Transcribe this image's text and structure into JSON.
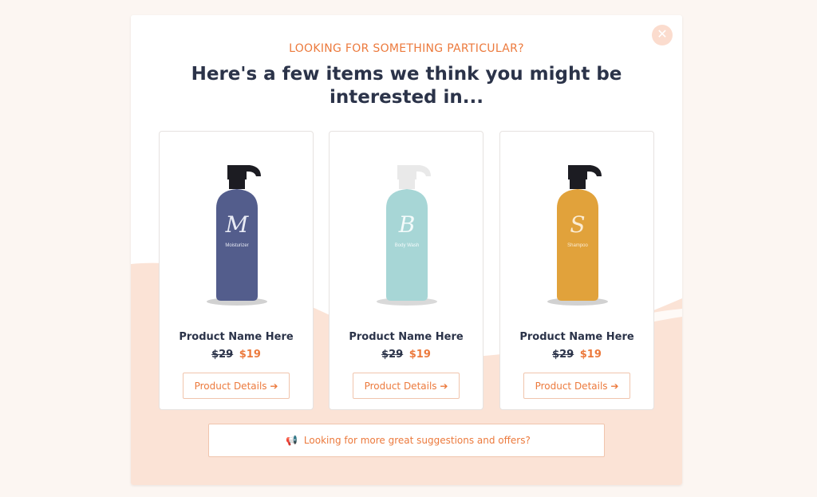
{
  "colors": {
    "accent": "#ec7a3d",
    "heading": "#2b3349",
    "page_bg": "#fcf6f2",
    "wave": "#fbe3d6",
    "close_bg": "#fbdcce"
  },
  "modal": {
    "close_icon": "close-icon",
    "eyebrow": "LOOKING FOR SOMETHING PARTICULAR?",
    "headline": "Here's a few items we think you might be interested in..."
  },
  "products": [
    {
      "name": "Product Name Here",
      "old_price": "$29",
      "new_price": "$19",
      "button_label": "Product Details",
      "button_icon": "arrow-right-icon",
      "bottle_color": "#535d8c",
      "bottle_letter": "M",
      "bottle_label": "Moisturizer"
    },
    {
      "name": "Product Name Here",
      "old_price": "$29",
      "new_price": "$19",
      "button_label": "Product Details",
      "button_icon": "arrow-right-icon",
      "bottle_color": "#a7d6d6",
      "bottle_letter": "B",
      "bottle_label": "Body Wash"
    },
    {
      "name": "Product Name Here",
      "old_price": "$29",
      "new_price": "$19",
      "button_label": "Product Details",
      "button_icon": "arrow-right-icon",
      "bottle_color": "#e1a23b",
      "bottle_letter": "S",
      "bottle_label": "Shampoo"
    }
  ],
  "more_button": {
    "icon": "megaphone-icon",
    "label": "Looking for more great suggestions and offers?"
  }
}
